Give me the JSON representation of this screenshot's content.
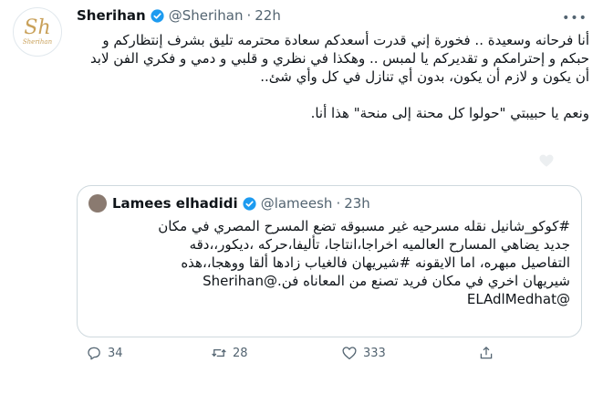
{
  "tweet": {
    "avatar_monogram": "Sh",
    "avatar_caption": "Sherihan",
    "display_name": "Sherihan",
    "handle": "@Sherihan",
    "separator": "·",
    "time": "22h",
    "text_paragraph_1": "أنا فرحانه وسعيدة .. فخورة إني قدرت أسعدكم سعادة محترمه تليق بشرف إنتظاركم و حبكم و إحترامكم و تقديركم يا لمبس .. وهكذا في نظري و قلبي و دمي و فكري الفن لابد أن يكون و لازم أن يكون، بدون أي تنازل في كل وأي شئ..",
    "text_paragraph_2": "ونعم يا حبيبتي \"حولوا كل محنة إلى منحة\" هذا أنا."
  },
  "quoted": {
    "display_name": "Lamees elhadidi",
    "handle": "@lameesh",
    "separator": "·",
    "time": "23h",
    "line_1": "#كوكو_شانيل نقله مسرحيه غير مسبوقه تضع المسرح المصري في مكان",
    "line_2": "جديد يضاهي المسارح العالميه اخراجا،انتاجا، تأليفا،حركه ،ديكور،،دقه",
    "line_3": "التفاصيل مبهره، اما الايقونه #شيريهان فالغياب زادها ألقا ووهجا،،هذه",
    "line_4": "شيريهان اخري في مكان فريد تصنع من المعاناه فن.@Sherihan",
    "line_5": "@ELAdlMedhat"
  },
  "actions": {
    "replies": "34",
    "retweets": "28",
    "likes": "333"
  }
}
